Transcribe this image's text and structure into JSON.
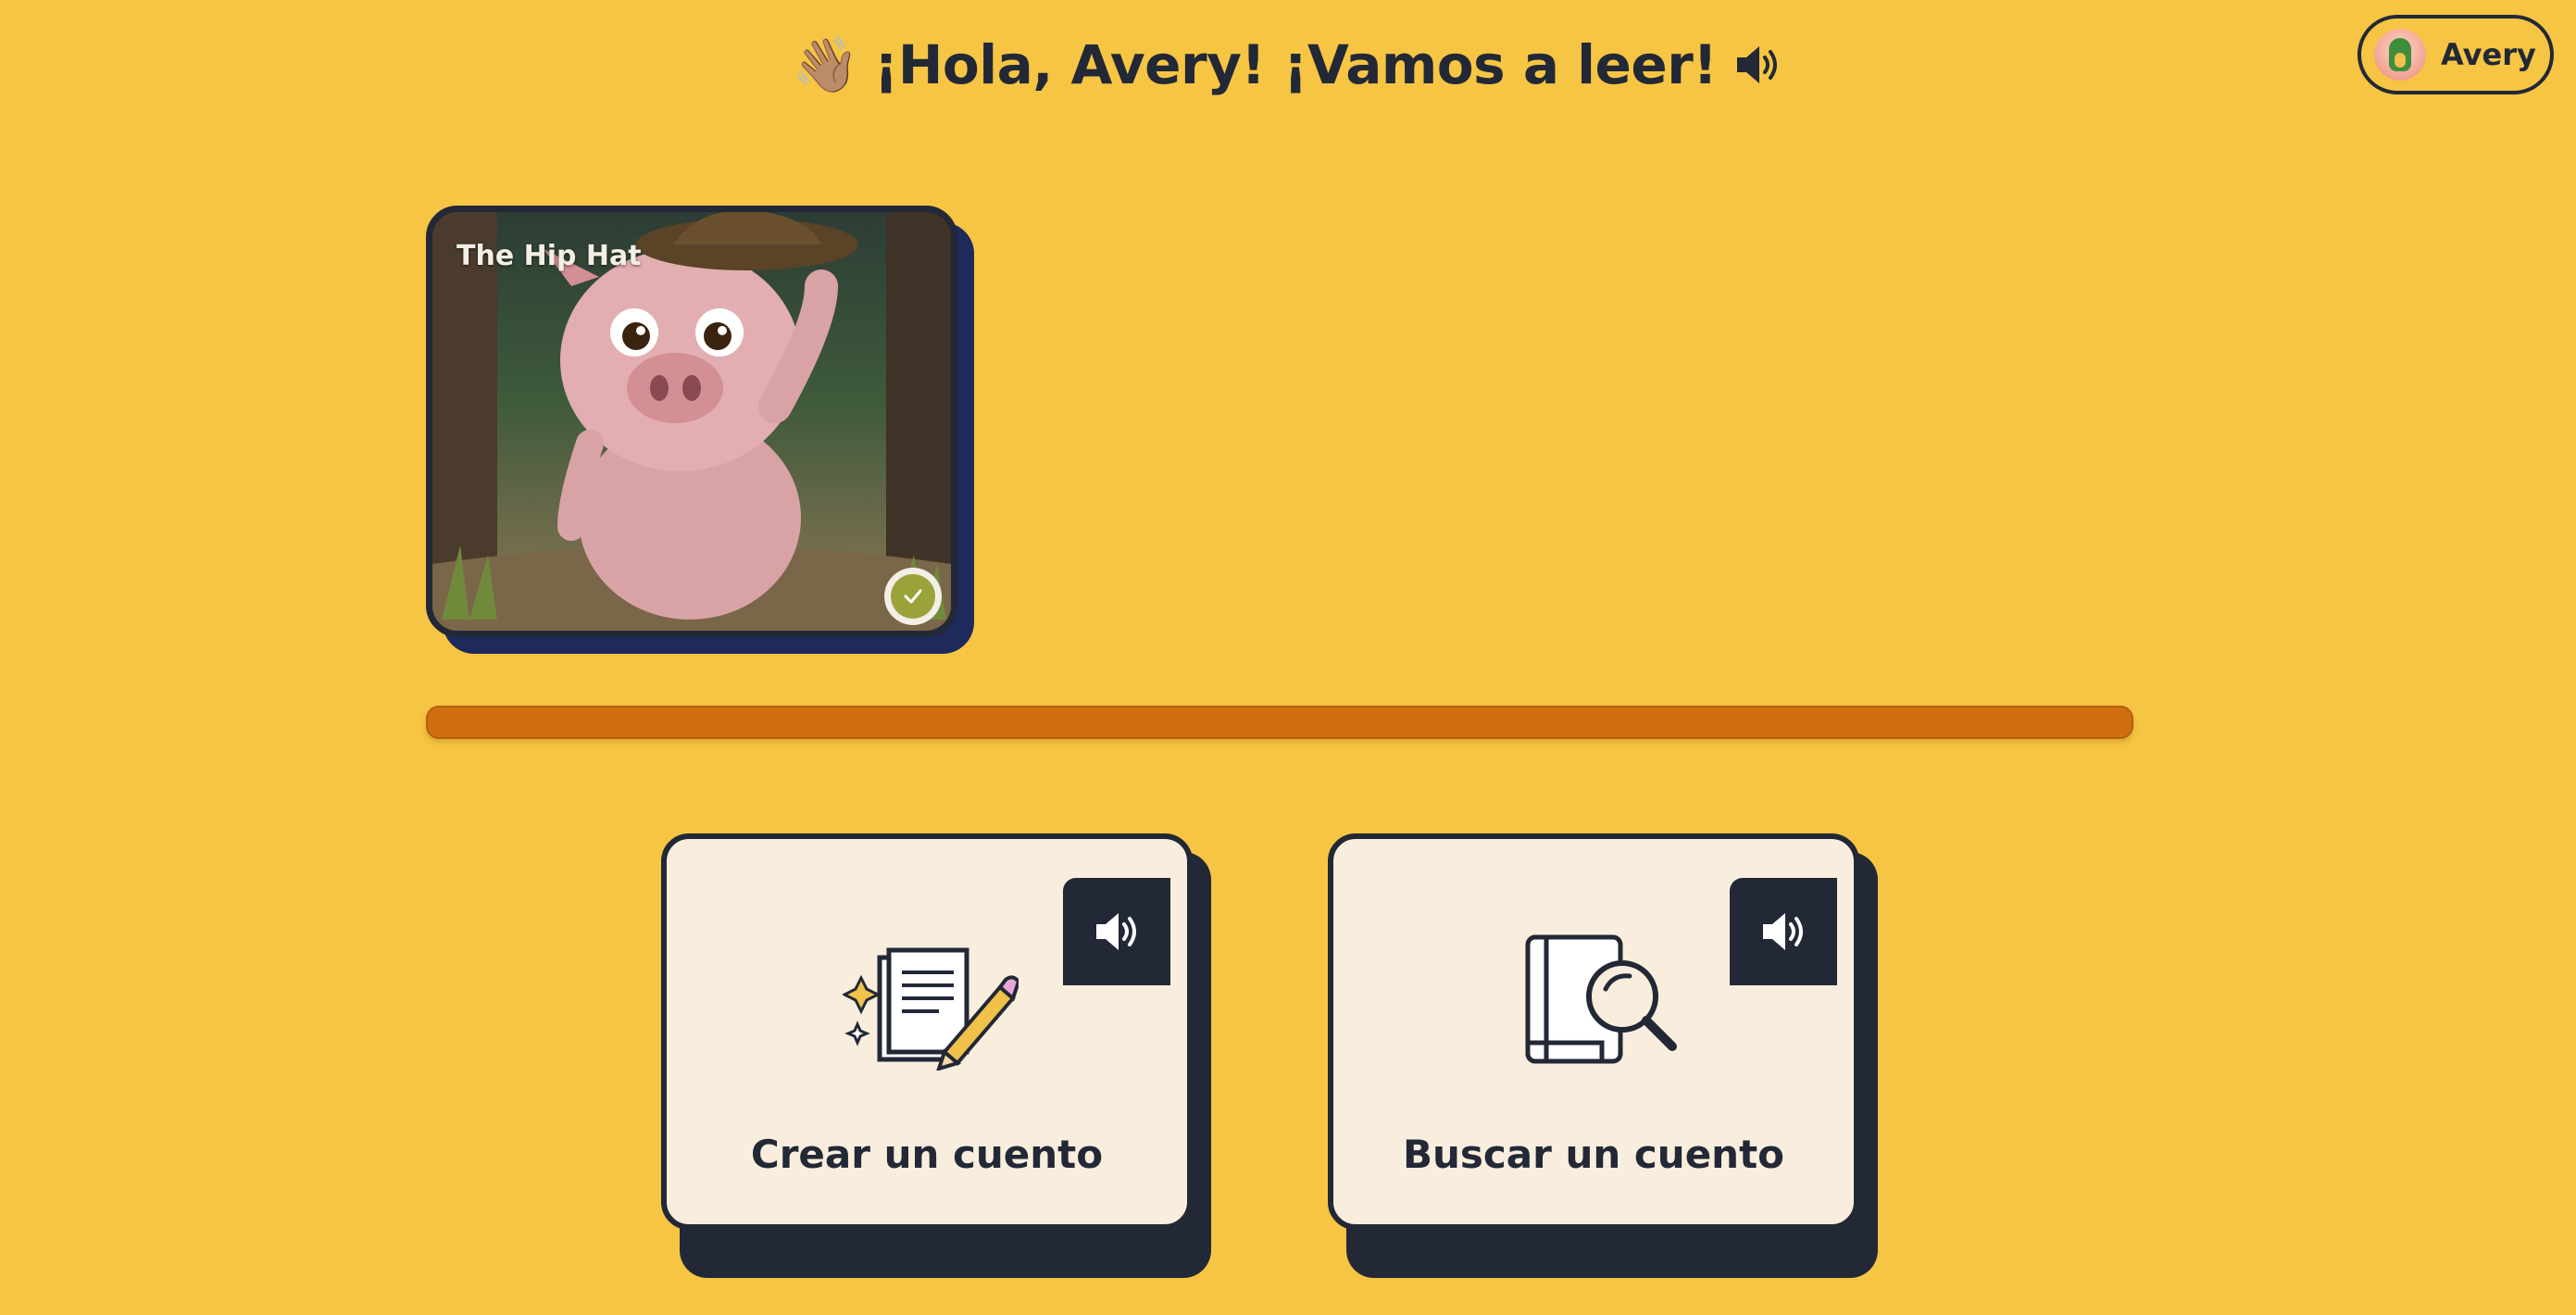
{
  "header": {
    "wave_emoji": "👋🏽",
    "greeting": "¡Hola, Avery! ¡Vamos a leer!",
    "speaker_icon": "speaker-icon"
  },
  "profile": {
    "name": "Avery",
    "avatar_icon": "dino-avatar"
  },
  "book": {
    "title": "The Hip Hat",
    "completed": true,
    "badge_icon": "check-icon"
  },
  "progress": {
    "fraction": 1.0
  },
  "actions": [
    {
      "label": "Crear un cuento",
      "icon": "create-story-icon",
      "speaker_icon": "speaker-icon"
    },
    {
      "label": "Buscar un cuento",
      "icon": "search-book-icon",
      "speaker_icon": "speaker-icon"
    }
  ],
  "colors": {
    "background": "#f6c543",
    "dark": "#222836",
    "card": "#f9eedd",
    "progress": "#d06f12",
    "check": "#9aa33a",
    "book_shadow": "#1e2a5c"
  }
}
